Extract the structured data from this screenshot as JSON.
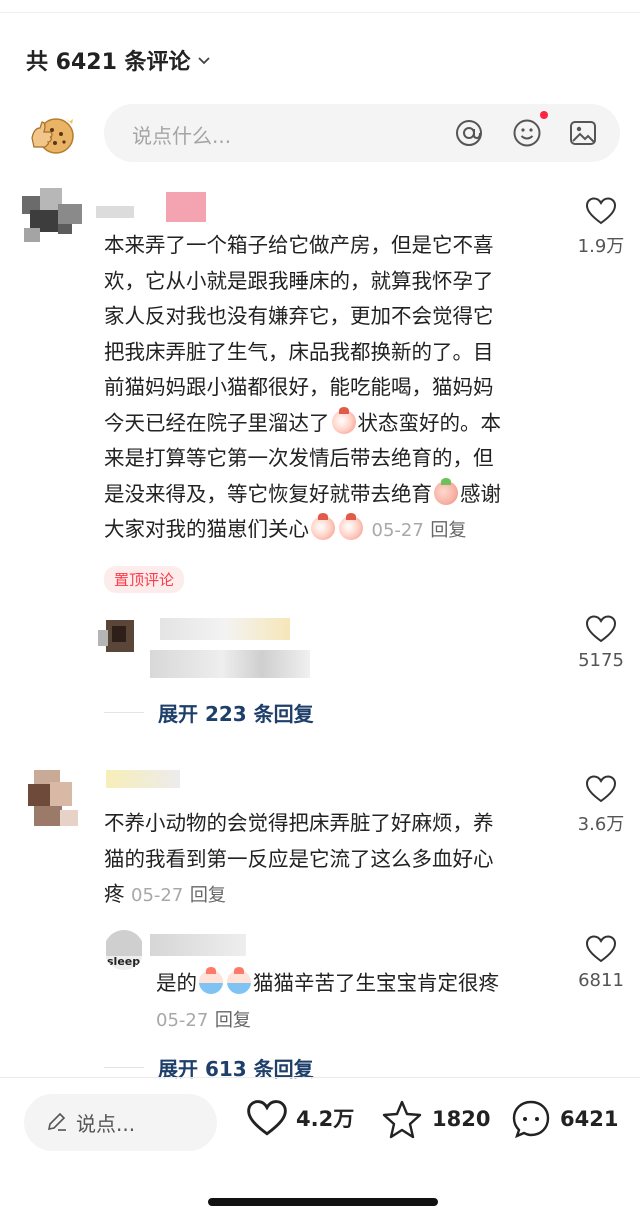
{
  "header": {
    "title": "共 6421 条评论",
    "chevron_icon": "chevron-down-icon"
  },
  "composer": {
    "placeholder": "说点什么...",
    "icons": [
      "at-icon",
      "emoji-icon",
      "image-icon"
    ],
    "notification_dot_color": "#ff2442"
  },
  "comments": [
    {
      "text_lines": [
        "本来弄了一个箱子给它做产房，但是它不喜",
        "欢，它从小就是跟我睡床的，就算我怀孕了",
        "家人反对我也没有嫌弃它，更加不会觉得它",
        "把我床弄脏了生气，床品我都换新的了。目",
        "前猫妈妈跟小猫都很好，能吃能喝，猫妈妈",
        "今天已经在院子里溜达了",
        "状态蛮好的。本",
        "来是打算等它第一次发情后带去绝育的，但",
        "是没来得及，等它恢复好就带去绝育",
        "感谢",
        "大家对我的猫崽们关心"
      ],
      "date": "05-27",
      "reply_label": "回复",
      "pinned_tag": "置顶评论",
      "like_count": "1.9万",
      "sub_reply_like_count": "5175",
      "expand_label": "展开 223 条回复"
    },
    {
      "text_lines": [
        "不养小动物的会觉得把床弄脏了好麻烦，养",
        "猫的我看到第一反应是它流了这么多血好心",
        "疼"
      ],
      "date": "05-27",
      "reply_label": "回复",
      "like_count": "3.6万",
      "sub_reply": {
        "text_before": "是的",
        "text_after": "猫猫辛苦了生宝宝肯定很疼",
        "date": "05-27",
        "reply_label": "回复",
        "like_count": "6811"
      },
      "expand_label": "展开 613 条回复"
    }
  ],
  "bottom_bar": {
    "input_placeholder": "说点...",
    "likes": "4.2万",
    "favorites": "1820",
    "comments": "6421"
  },
  "colors": {
    "accent_red": "#ff2442",
    "link_blue": "#1f3f6b"
  }
}
